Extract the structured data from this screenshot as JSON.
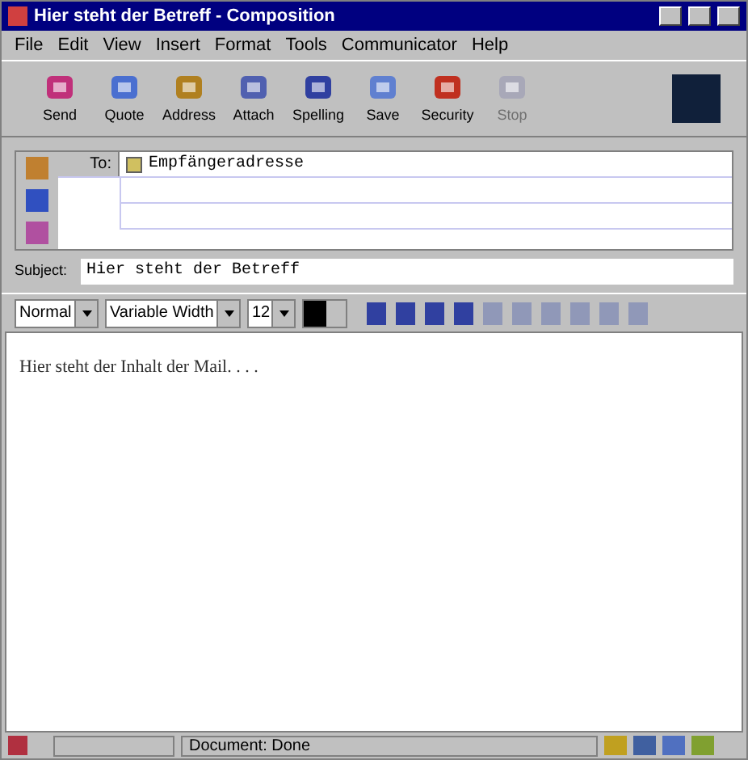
{
  "window": {
    "title": "Hier steht der Betreff - Composition"
  },
  "menu": [
    "File",
    "Edit",
    "View",
    "Insert",
    "Format",
    "Tools",
    "Communicator",
    "Help"
  ],
  "toolbar": [
    {
      "label": "Send",
      "disabled": false
    },
    {
      "label": "Quote",
      "disabled": false
    },
    {
      "label": "Address",
      "disabled": false
    },
    {
      "label": "Attach",
      "disabled": false
    },
    {
      "label": "Spelling",
      "disabled": false
    },
    {
      "label": "Save",
      "disabled": false
    },
    {
      "label": "Security",
      "disabled": false
    },
    {
      "label": "Stop",
      "disabled": true
    }
  ],
  "address": {
    "field": "To:",
    "value": "Empfängeradresse"
  },
  "subject": {
    "label": "Subject:",
    "value": "Hier steht der Betreff"
  },
  "format_bar": {
    "paragraph": "Normal",
    "font": "Variable Width",
    "size": "12"
  },
  "body": "Hier steht der Inhalt der Mail. . . .",
  "status_bar": {
    "text": "Document: Done"
  }
}
